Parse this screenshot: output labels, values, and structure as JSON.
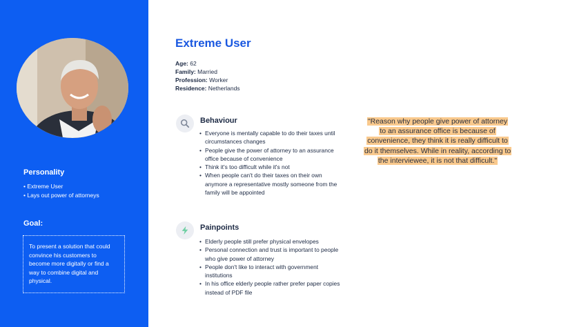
{
  "persona": {
    "title": "Extreme User",
    "facts": [
      {
        "key": "Age:",
        "value": " 62"
      },
      {
        "key": "Family:",
        "value": " Married"
      },
      {
        "key": "Profession:",
        "value": " Worker"
      },
      {
        "key": "Residence:",
        "value": " Netherlands"
      }
    ]
  },
  "sidebar": {
    "personality_title": "Personality",
    "personality_items": [
      "Extreme User",
      "Lays out power of attorneys"
    ],
    "goal_title": "Goal:",
    "goal_text": "To present a solution that could convince his customers to become more digitally or find a way to combine digital and physical."
  },
  "behaviour": {
    "title": "Behaviour",
    "icon": "search-icon",
    "items": [
      "Everyone is mentally capable to do their taxes until circumstances changes",
      "People give the power of attorney to an assurance office because of convenience",
      "Think it's too difficult while it's not",
      "When people can't do their taxes on their own anymore a representative mostly someone from the family will be appointed"
    ]
  },
  "painpoints": {
    "title": "Painpoints",
    "icon": "lightning-icon",
    "items": [
      "Elderly people still prefer physical envelopes",
      "Personal connection and trust is important to people who give power of attorney",
      "People don't like to interact with government institutions",
      "In his office elderly people rather prefer paper copies instead of PDF file"
    ]
  },
  "quote": "\"Reason why people give power of attorney to an assurance office is because of convenience, they think it is really difficult to do it themselves. While in reality, according to the interviewee, it is not that difficult.\"",
  "colors": {
    "sidebar": "#0d5ef2",
    "title": "#1a58e0",
    "highlight": "#f9c98d"
  }
}
